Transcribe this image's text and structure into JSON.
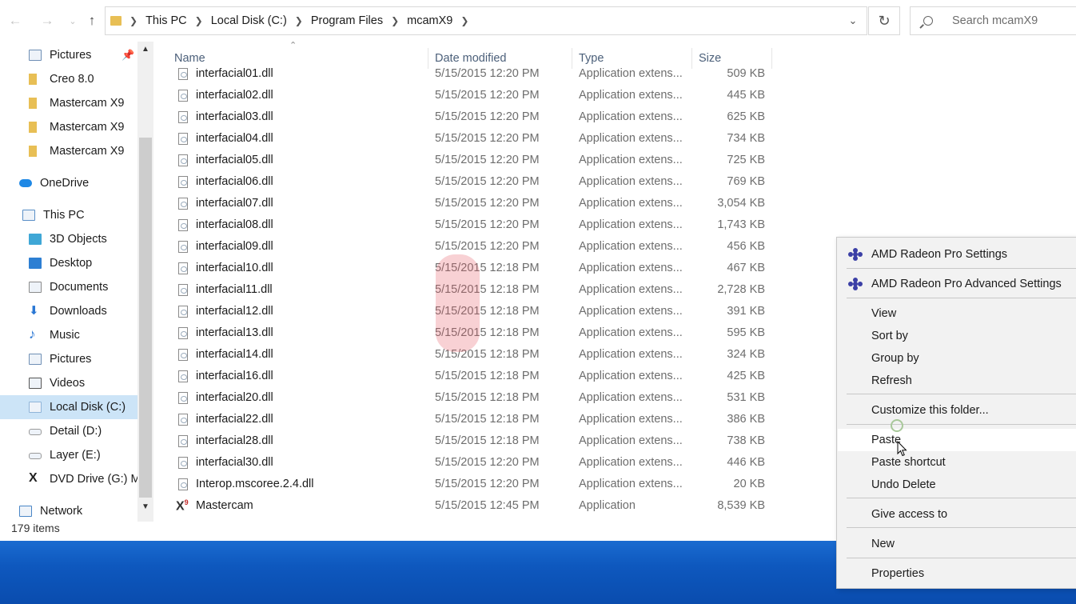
{
  "address": {
    "crumbs": [
      "This PC",
      "Local Disk (C:)",
      "Program Files",
      "mcamX9"
    ],
    "search_placeholder": "Search mcamX9"
  },
  "nav": {
    "items": [
      {
        "label": "Pictures",
        "icon": "pictures-icon",
        "pinned": true
      },
      {
        "label": "Creo 8.0",
        "icon": "folder-icon"
      },
      {
        "label": "Mastercam X9",
        "icon": "folder-icon"
      },
      {
        "label": "Mastercam X9",
        "icon": "folder-icon"
      },
      {
        "label": "Mastercam X9",
        "icon": "folder-icon"
      },
      {
        "label": "OneDrive",
        "icon": "cloud-icon"
      },
      {
        "label": "This PC",
        "icon": "computer-icon"
      },
      {
        "label": "3D Objects",
        "icon": "cube-icon"
      },
      {
        "label": "Desktop",
        "icon": "desktop-icon"
      },
      {
        "label": "Documents",
        "icon": "document-icon"
      },
      {
        "label": "Downloads",
        "icon": "download-arrow-icon"
      },
      {
        "label": "Music",
        "icon": "music-note-icon"
      },
      {
        "label": "Pictures",
        "icon": "pictures-icon"
      },
      {
        "label": "Videos",
        "icon": "film-icon"
      },
      {
        "label": "Local Disk (C:)",
        "icon": "windows-drive-icon",
        "selected": true
      },
      {
        "label": "Detail (D:)",
        "icon": "drive-icon"
      },
      {
        "label": "Layer (E:)",
        "icon": "drive-icon"
      },
      {
        "label": "DVD Drive (G:) M",
        "icon": "mastercam-dvd-icon"
      },
      {
        "label": "Network",
        "icon": "network-icon"
      }
    ],
    "status": "179 items"
  },
  "columns": {
    "name": "Name",
    "date": "Date modified",
    "type": "Type",
    "size": "Size"
  },
  "files": [
    {
      "name": "interfacial01.dll",
      "date": "5/15/2015 12:20 PM",
      "type": "Application extens...",
      "size": "509 KB"
    },
    {
      "name": "interfacial02.dll",
      "date": "5/15/2015 12:20 PM",
      "type": "Application extens...",
      "size": "445 KB"
    },
    {
      "name": "interfacial03.dll",
      "date": "5/15/2015 12:20 PM",
      "type": "Application extens...",
      "size": "625 KB"
    },
    {
      "name": "interfacial04.dll",
      "date": "5/15/2015 12:20 PM",
      "type": "Application extens...",
      "size": "734 KB"
    },
    {
      "name": "interfacial05.dll",
      "date": "5/15/2015 12:20 PM",
      "type": "Application extens...",
      "size": "725 KB"
    },
    {
      "name": "interfacial06.dll",
      "date": "5/15/2015 12:20 PM",
      "type": "Application extens...",
      "size": "769 KB"
    },
    {
      "name": "interfacial07.dll",
      "date": "5/15/2015 12:20 PM",
      "type": "Application extens...",
      "size": "3,054 KB"
    },
    {
      "name": "interfacial08.dll",
      "date": "5/15/2015 12:20 PM",
      "type": "Application extens...",
      "size": "1,743 KB"
    },
    {
      "name": "interfacial09.dll",
      "date": "5/15/2015 12:20 PM",
      "type": "Application extens...",
      "size": "456 KB"
    },
    {
      "name": "interfacial10.dll",
      "date": "5/15/2015 12:18 PM",
      "type": "Application extens...",
      "size": "467 KB"
    },
    {
      "name": "interfacial11.dll",
      "date": "5/15/2015 12:18 PM",
      "type": "Application extens...",
      "size": "2,728 KB"
    },
    {
      "name": "interfacial12.dll",
      "date": "5/15/2015 12:18 PM",
      "type": "Application extens...",
      "size": "391 KB"
    },
    {
      "name": "interfacial13.dll",
      "date": "5/15/2015 12:18 PM",
      "type": "Application extens...",
      "size": "595 KB"
    },
    {
      "name": "interfacial14.dll",
      "date": "5/15/2015 12:18 PM",
      "type": "Application extens...",
      "size": "324 KB"
    },
    {
      "name": "interfacial16.dll",
      "date": "5/15/2015 12:18 PM",
      "type": "Application extens...",
      "size": "425 KB"
    },
    {
      "name": "interfacial20.dll",
      "date": "5/15/2015 12:18 PM",
      "type": "Application extens...",
      "size": "531 KB"
    },
    {
      "name": "interfacial22.dll",
      "date": "5/15/2015 12:18 PM",
      "type": "Application extens...",
      "size": "386 KB"
    },
    {
      "name": "interfacial28.dll",
      "date": "5/15/2015 12:18 PM",
      "type": "Application extens...",
      "size": "738 KB"
    },
    {
      "name": "interfacial30.dll",
      "date": "5/15/2015 12:20 PM",
      "type": "Application extens...",
      "size": "446 KB"
    },
    {
      "name": "Interop.mscoree.2.4.dll",
      "date": "5/15/2015 12:20 PM",
      "type": "Application extens...",
      "size": "20 KB"
    },
    {
      "name": "Mastercam",
      "date": "5/15/2015 12:45 PM",
      "type": "Application",
      "size": "8,539 KB",
      "icon": "mastercam-x-icon"
    }
  ],
  "context_menu": {
    "items": [
      {
        "label": "AMD Radeon Pro Settings",
        "icon": "amd-radeon-icon"
      },
      {
        "label": "AMD Radeon Pro Advanced Settings",
        "icon": "amd-radeon-icon"
      },
      {
        "label": "View"
      },
      {
        "label": "Sort by"
      },
      {
        "label": "Group by"
      },
      {
        "label": "Refresh"
      },
      {
        "label": "Customize this folder..."
      },
      {
        "label": "Paste",
        "hover": true
      },
      {
        "label": "Paste shortcut"
      },
      {
        "label": "Undo Delete"
      },
      {
        "label": "Give access to"
      },
      {
        "label": "New"
      },
      {
        "label": "Properties"
      }
    ]
  },
  "colors": {
    "accent_selected": "#cce4f7",
    "taskbar": "#0e58be",
    "amd_icon": "#3b3fa6"
  }
}
